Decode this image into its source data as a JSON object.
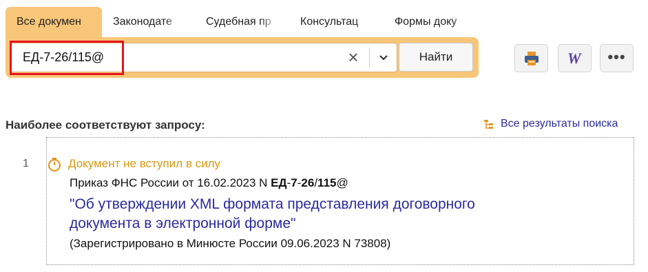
{
  "tabs": [
    {
      "label": "Все докумен",
      "active": true
    },
    {
      "label": "Законодате",
      "active": false
    },
    {
      "label": "Судебная пр",
      "active": false
    },
    {
      "label": "Консультац",
      "active": false
    },
    {
      "label": "Формы доку",
      "active": false
    }
  ],
  "search": {
    "value": "ЕД-7-26/115@",
    "clear_icon": "×",
    "dropdown_icon": "chevron-down-icon",
    "find_label": "Найти"
  },
  "toolbar": {
    "print_icon": "printer-icon",
    "word_icon": "word-export-icon",
    "more_icon": "more-dots-icon",
    "more_glyph": "•••"
  },
  "results": {
    "section_title": "Наиболее соответствуют запросу:",
    "all_results_label": "Все результаты поиска",
    "items": [
      {
        "number": "1",
        "status": "Документ не вступил в силу",
        "ref_prefix": "Приказ ФНС России от 16.02.2023 N ",
        "ref_parts": [
          "ЕД",
          "-",
          "7",
          "-",
          "26",
          "/",
          "115",
          "@"
        ],
        "title_line1": "\"Об утверждении XML формата представления договорного",
        "title_line2": "документа в электронной форме\"",
        "note": "(Зарегистрировано в Минюсте России 09.06.2023 N 73808)"
      }
    ]
  },
  "colors": {
    "accent": "#f8c678",
    "highlight_frame": "#e5141f",
    "link": "#2a2aa0",
    "status": "#d69a14"
  }
}
